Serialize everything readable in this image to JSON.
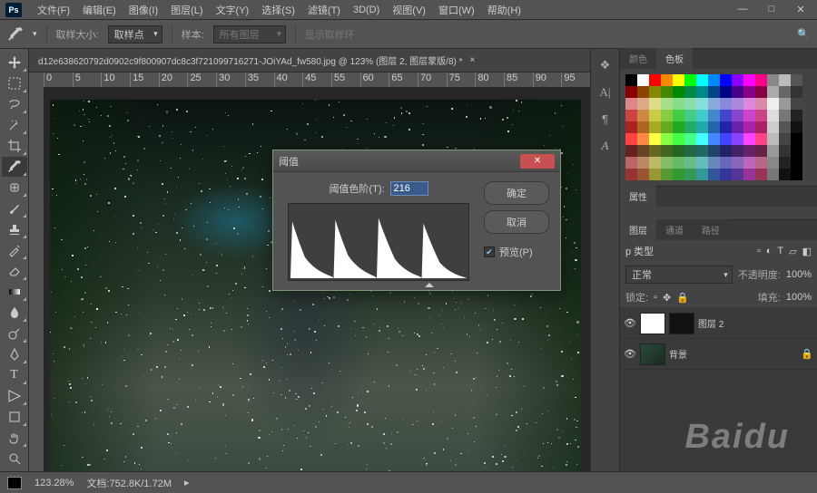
{
  "app": {
    "logo": "Ps"
  },
  "menu": [
    "文件(F)",
    "编辑(E)",
    "图像(I)",
    "图层(L)",
    "文字(Y)",
    "选择(S)",
    "滤镜(T)",
    "3D(D)",
    "视图(V)",
    "窗口(W)",
    "帮助(H)"
  ],
  "optionsBar": {
    "sampleSizeLabel": "取样大小:",
    "sampleSize": "取样点",
    "sampleLabel": "样本:",
    "sample": "所有图层",
    "showRingLabel": "显示取样环"
  },
  "docTab": "d12e638620792d0902c9f800907dc8c3f721099716271-JOiYAd_fw580.jpg @ 123% (图层 2, 图层蒙版/8) *",
  "rulerH": [
    "0",
    "5",
    "10",
    "15",
    "20",
    "25",
    "30",
    "35",
    "40",
    "45",
    "55",
    "60",
    "65",
    "70",
    "75",
    "80",
    "85",
    "90",
    "95"
  ],
  "dialog": {
    "title": "阈值",
    "fieldLabel": "阈值色阶(T):",
    "value": "216",
    "ok": "确定",
    "cancel": "取消",
    "preview": "预览(P)"
  },
  "panels": {
    "colorTabs": [
      "颜色",
      "色板"
    ],
    "swatches": [
      [
        "#000",
        "#fff",
        "#f00",
        "#f80",
        "#ff0",
        "#0f0",
        "#0ff",
        "#08f",
        "#00f",
        "#80f",
        "#f0f",
        "#f08",
        "#888",
        "#bbb",
        "#555"
      ],
      [
        "#800",
        "#840",
        "#880",
        "#480",
        "#080",
        "#084",
        "#088",
        "#048",
        "#008",
        "#408",
        "#808",
        "#804",
        "#aaa",
        "#666",
        "#333"
      ],
      [
        "#d88",
        "#da8",
        "#dd8",
        "#ad8",
        "#8d8",
        "#8da",
        "#8dd",
        "#8ad",
        "#88d",
        "#a8d",
        "#d8d",
        "#d8a",
        "#eee",
        "#999",
        "#444"
      ],
      [
        "#c44",
        "#c84",
        "#cc4",
        "#8c4",
        "#4c4",
        "#4c8",
        "#4cc",
        "#48c",
        "#44c",
        "#84c",
        "#c4c",
        "#c48",
        "#ddd",
        "#777",
        "#222"
      ],
      [
        "#a22",
        "#a62",
        "#aa2",
        "#6a2",
        "#2a2",
        "#2a6",
        "#2aa",
        "#26a",
        "#22a",
        "#62a",
        "#a2a",
        "#a26",
        "#ccc",
        "#555",
        "#111"
      ],
      [
        "#f44",
        "#f84",
        "#ff4",
        "#8f4",
        "#4f4",
        "#4f8",
        "#4ff",
        "#48f",
        "#44f",
        "#84f",
        "#f4f",
        "#f48",
        "#bbb",
        "#444",
        "#000"
      ],
      [
        "#622",
        "#642",
        "#662",
        "#462",
        "#262",
        "#264",
        "#266",
        "#246",
        "#226",
        "#426",
        "#626",
        "#624",
        "#999",
        "#333",
        "#000"
      ],
      [
        "#b66",
        "#b86",
        "#bb6",
        "#8b6",
        "#6b6",
        "#6b8",
        "#6bb",
        "#68b",
        "#66b",
        "#86b",
        "#b6b",
        "#b68",
        "#888",
        "#222",
        "#000"
      ],
      [
        "#933",
        "#953",
        "#993",
        "#593",
        "#393",
        "#395",
        "#399",
        "#359",
        "#339",
        "#539",
        "#939",
        "#935",
        "#777",
        "#111",
        "#000"
      ]
    ],
    "propsTab": "属性",
    "propsBody": "",
    "layerTabs": [
      "图层",
      "通道",
      "路径"
    ],
    "blendMode": "正常",
    "opacityLabel": "不透明度:",
    "opacity": "100%",
    "lockLabel": "锁定:",
    "fillLabel": "填充:",
    "fill": "100%",
    "layers": [
      {
        "name": "图层 2",
        "thumbs": [
          "white",
          "dark"
        ]
      },
      {
        "name": "背景",
        "thumbs": [
          "bg"
        ]
      }
    ],
    "kindLabel": "p 类型"
  },
  "status": {
    "zoom": "123.28%",
    "docLabel": "文档:",
    "docSize": "752.8K/1.72M"
  },
  "watermark": "Baidu"
}
